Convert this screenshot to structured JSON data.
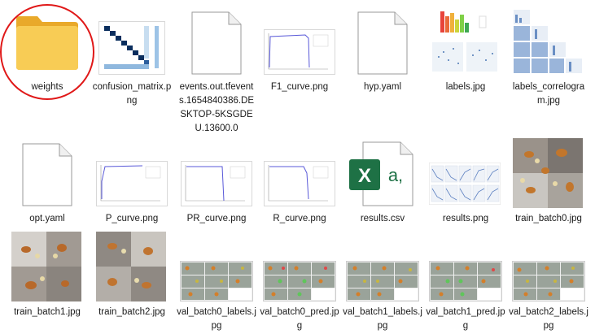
{
  "files": [
    {
      "name": "weights",
      "icon": "folder-icon"
    },
    {
      "name": "confusion_matrix.png",
      "icon": "image-thumbnail"
    },
    {
      "name": "events.out.tfevents.1654840386.DESKTOP-5KSGDEU.13600.0",
      "icon": "blank-file-icon"
    },
    {
      "name": "F1_curve.png",
      "icon": "image-thumbnail"
    },
    {
      "name": "hyp.yaml",
      "icon": "blank-file-icon"
    },
    {
      "name": "labels.jpg",
      "icon": "image-thumbnail"
    },
    {
      "name": "labels_correlogram.jpg",
      "icon": "image-thumbnail"
    },
    {
      "name": "opt.yaml",
      "icon": "blank-file-icon"
    },
    {
      "name": "P_curve.png",
      "icon": "image-thumbnail"
    },
    {
      "name": "PR_curve.png",
      "icon": "image-thumbnail"
    },
    {
      "name": "R_curve.png",
      "icon": "image-thumbnail"
    },
    {
      "name": "results.csv",
      "icon": "excel-icon"
    },
    {
      "name": "results.png",
      "icon": "image-thumbnail"
    },
    {
      "name": "train_batch0.jpg",
      "icon": "image-thumbnail"
    },
    {
      "name": "train_batch1.jpg",
      "icon": "image-thumbnail"
    },
    {
      "name": "train_batch2.jpg",
      "icon": "image-thumbnail"
    },
    {
      "name": "val_batch0_labels.jpg",
      "icon": "image-thumbnail"
    },
    {
      "name": "val_batch0_pred.jpg",
      "icon": "image-thumbnail"
    },
    {
      "name": "val_batch1_labels.jpg",
      "icon": "image-thumbnail"
    },
    {
      "name": "val_batch1_pred.jpg",
      "icon": "image-thumbnail"
    },
    {
      "name": "val_batch2_labels.jpg",
      "icon": "image-thumbnail"
    }
  ],
  "excel_icon_text": {
    "x": "X",
    "a": "a,"
  },
  "colors": {
    "highlight": "#e01818",
    "folder": "#f6c445",
    "excel": "#1e7145"
  }
}
